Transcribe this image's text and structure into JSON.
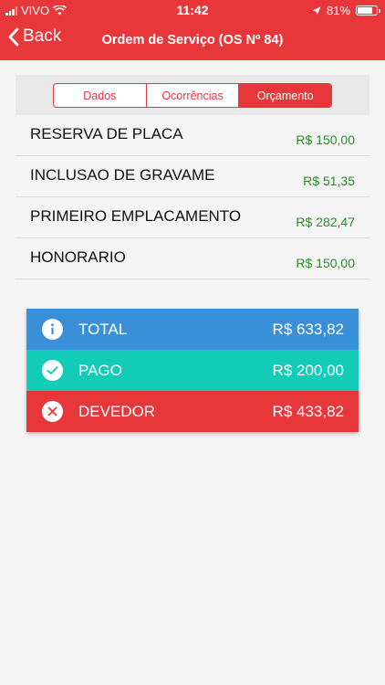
{
  "status_bar": {
    "carrier": "VIVO",
    "time": "11:42",
    "battery": "81%",
    "battery_level": 0.81
  },
  "nav": {
    "back_label": "Back",
    "title": "Ordem de Serviço (OS Nº 84)"
  },
  "tabs": [
    {
      "label": "Dados",
      "active": false
    },
    {
      "label": "Ocorrências",
      "active": false
    },
    {
      "label": "Orçamento",
      "active": true
    }
  ],
  "items": [
    {
      "label": "RESERVA DE PLACA",
      "value": "R$ 150,00"
    },
    {
      "label": "INCLUSAO DE GRAVAME",
      "value": "R$ 51,35"
    },
    {
      "label": "PRIMEIRO EMPLACAMENTO",
      "value": "R$ 282,47"
    },
    {
      "label": "HONORARIO",
      "value": "R$ 150,00"
    }
  ],
  "summary": {
    "total": {
      "label": "TOTAL",
      "value": "R$ 633,82",
      "color": "#3a8fd9",
      "icon": "info-icon"
    },
    "pago": {
      "label": "PAGO",
      "value": "R$ 200,00",
      "color": "#12ccb8",
      "icon": "check-icon"
    },
    "devedor": {
      "label": "DEVEDOR",
      "value": "R$ 433,82",
      "color": "#e8373b",
      "icon": "close-icon"
    }
  },
  "colors": {
    "brand": "#e8373b",
    "value_green": "#2e8b2e"
  }
}
